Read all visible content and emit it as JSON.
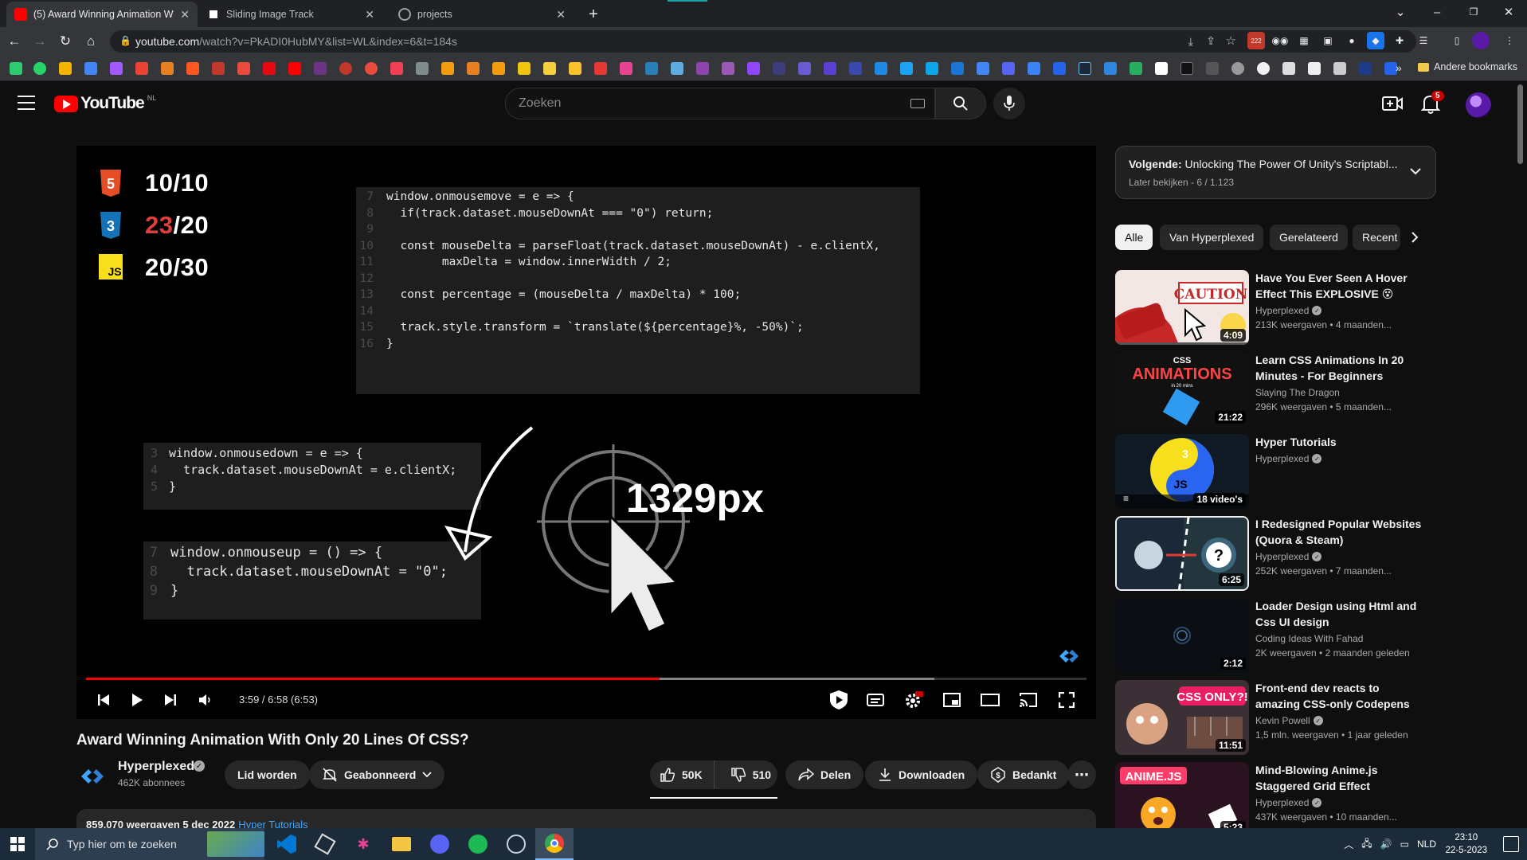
{
  "browser": {
    "tabs": [
      {
        "label": "(5) Award Winning Animation W",
        "active": true
      },
      {
        "label": "Sliding Image Track",
        "active": false
      },
      {
        "label": "projects",
        "active": false
      }
    ],
    "url_host": "youtube.com",
    "url_rest": "/watch?v=PkADI0HubMY&list=WL&index=6&t=184s",
    "other_bookmarks": "Andere bookmarks",
    "ext_badge": "222"
  },
  "yt": {
    "logo": "YouTube",
    "country": "NL",
    "search_placeholder": "Zoeken",
    "notif_count": "5"
  },
  "video": {
    "scores": [
      {
        "icon": "html5-icon",
        "left": "10",
        "sep": "/",
        "right": "10"
      },
      {
        "icon": "css3-icon",
        "left": "23",
        "sep": "/",
        "right": "20"
      },
      {
        "icon": "js-icon",
        "left": "20",
        "sep": "/",
        "right": "30"
      }
    ],
    "code_main": [
      {
        "n": "7",
        "t": "window.onmousemove = e => {"
      },
      {
        "n": "8",
        "t": "  if(track.dataset.mouseDownAt === \"0\") return;"
      },
      {
        "n": "9",
        "t": ""
      },
      {
        "n": "10",
        "t": "  const mouseDelta = parseFloat(track.dataset.mouseDownAt) - e.clientX,"
      },
      {
        "n": "11",
        "t": "        maxDelta = window.innerWidth / 2;"
      },
      {
        "n": "12",
        "t": ""
      },
      {
        "n": "13",
        "t": "  const percentage = (mouseDelta / maxDelta) * 100;"
      },
      {
        "n": "14",
        "t": ""
      },
      {
        "n": "15",
        "t": "  track.style.transform = `translate(${percentage}%, -50%)`;"
      },
      {
        "n": "16",
        "t": "}"
      }
    ],
    "code_down": [
      {
        "n": "3",
        "t": "window.onmousedown = e => {"
      },
      {
        "n": "4",
        "t": "  track.dataset.mouseDownAt = e.clientX;"
      },
      {
        "n": "5",
        "t": "}"
      }
    ],
    "code_up": [
      {
        "n": "7",
        "t": "window.onmouseup = () => {"
      },
      {
        "n": "8",
        "t": "  track.dataset.mouseDownAt = \"0\";"
      },
      {
        "n": "9",
        "t": "}"
      }
    ],
    "overlay_text": "1329px",
    "time": "3:59 / 6:58 (6:53)",
    "progress_played": 0.573,
    "progress_buffered": 0.848,
    "title": "Award Winning Animation With Only 20 Lines Of CSS?",
    "channel": "Hyperplexed",
    "subscribers": "462K abonnees",
    "join_label": "Lid worden",
    "subscribed_label": "Geabonneerd",
    "likes": "50K",
    "dislikes": "510",
    "share_label": "Delen",
    "download_label": "Downloaden",
    "thanks_label": "Bedankt",
    "desc_views": "859.070 weergaven  5 dec 2022",
    "desc_tag": "Hyper Tutorials"
  },
  "sidebar": {
    "playlist_next_label": "Volgende:",
    "playlist_next_title": "Unlocking The Power Of Unity's Scriptabl...",
    "playlist_sub": "Later bekijken - 6 / 1.123",
    "chips": [
      "Alle",
      "Van Hyperplexed",
      "Gerelateerd",
      "Recent"
    ],
    "recs": [
      {
        "title": "Have You Ever Seen A Hover Effect This EXPLOSIVE 😵",
        "channel": "Hyperplexed",
        "verified": true,
        "meta": "213K weergaven • 4 maanden...",
        "duration": "4:09",
        "thumb": "caution"
      },
      {
        "title": "Learn CSS Animations In 20 Minutes - For Beginners",
        "channel": "Slaying The Dragon",
        "verified": false,
        "meta": "296K weergaven • 5 maanden...",
        "duration": "21:22",
        "thumb": "animations"
      },
      {
        "title": "Hyper Tutorials",
        "channel": "Hyperplexed",
        "verified": true,
        "meta": "",
        "duration": "18 video's",
        "thumb": "playlist"
      },
      {
        "title": "I Redesigned Popular Websites (Quora & Steam)",
        "channel": "Hyperplexed",
        "verified": true,
        "meta": "252K weergaven • 7 maanden...",
        "duration": "6:25",
        "thumb": "steam"
      },
      {
        "title": "Loader Design using Html and Css UI design",
        "channel": "Coding Ideas With Fahad",
        "verified": false,
        "meta": "2K weergaven • 2 maanden geleden",
        "duration": "2:12",
        "thumb": "loader"
      },
      {
        "title": "Front-end dev reacts to amazing CSS-only Codepens",
        "channel": "Kevin Powell",
        "verified": true,
        "meta": "1,5 mln. weergaven • 1 jaar geleden",
        "duration": "11:51",
        "thumb": "cssonly"
      },
      {
        "title": "Mind-Blowing Anime.js Staggered Grid Effect",
        "channel": "Hyperplexed",
        "verified": true,
        "meta": "437K weergaven • 10 maanden...",
        "duration": "5:23",
        "thumb": "animejs"
      }
    ],
    "thumb_texts": {
      "caution": "CAUTION",
      "css": "CSS",
      "animations": "ANIMATIONS",
      "in20": "in 20 mins",
      "cssonly": "CSS ONLY?!",
      "animejs": "ANIME.JS",
      "js": "JS",
      "q": "?"
    }
  },
  "taskbar": {
    "search_placeholder": "Typ hier om te zoeken",
    "lang": "NLD",
    "time": "23:10",
    "date": "22-5-2023"
  }
}
